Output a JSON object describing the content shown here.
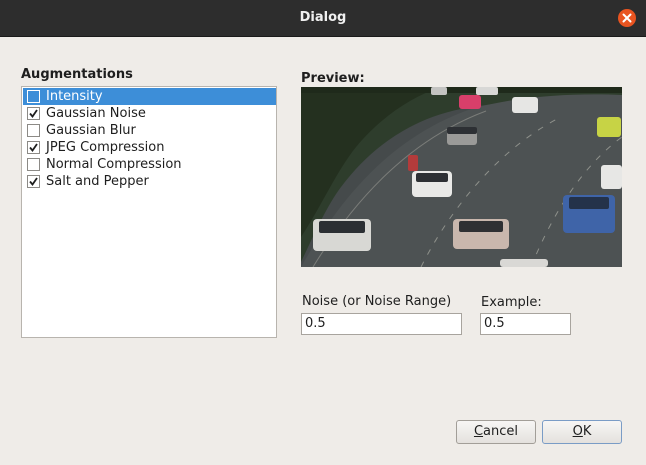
{
  "window": {
    "title": "Dialog"
  },
  "augmentations": {
    "label": "Augmentations",
    "items": [
      {
        "label": "Intensity",
        "checked": false,
        "selected": true
      },
      {
        "label": "Gaussian Noise",
        "checked": true,
        "selected": false
      },
      {
        "label": "Gaussian Blur",
        "checked": false,
        "selected": false
      },
      {
        "label": "JPEG Compression",
        "checked": true,
        "selected": false
      },
      {
        "label": "Normal Compression",
        "checked": false,
        "selected": false
      },
      {
        "label": "Salt and Pepper",
        "checked": true,
        "selected": false
      }
    ]
  },
  "preview": {
    "label": "Preview:"
  },
  "noise": {
    "label": "Noise (or Noise Range)",
    "value": "0.5"
  },
  "example": {
    "label": "Example:",
    "value": "0.5"
  },
  "buttons": {
    "cancel": {
      "mnemonic": "C",
      "rest": "ancel"
    },
    "ok": {
      "mnemonic": "O",
      "rest": "K"
    }
  },
  "colors": {
    "titlebar": "#2d2d2d",
    "close": "#e95420",
    "selection": "#3d8ed8",
    "background": "#efece8"
  }
}
